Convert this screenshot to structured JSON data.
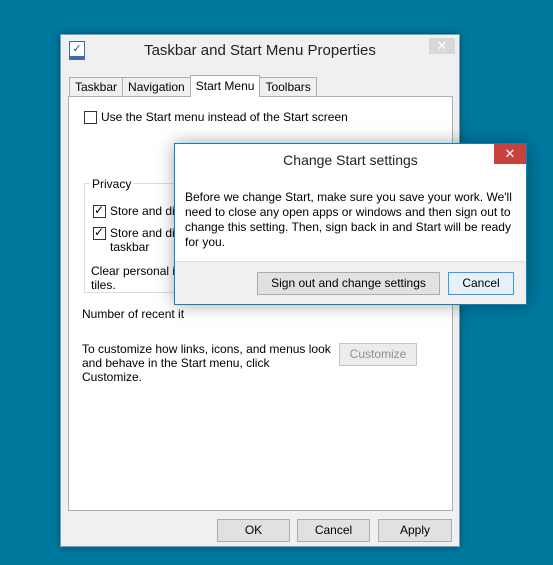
{
  "window": {
    "title": "Taskbar and Start Menu Properties",
    "close_glyph": "✕",
    "tabs": [
      {
        "label": "Taskbar"
      },
      {
        "label": "Navigation"
      },
      {
        "label": "Start Menu"
      },
      {
        "label": "Toolbars"
      }
    ],
    "start_menu_option": "Use the Start menu instead of the Start screen",
    "privacy": {
      "legend": "Privacy",
      "store_programs": "Store and disp",
      "store_items": "Store and disp",
      "store_items_line2": "taskbar",
      "clear_text": "Clear personal inf",
      "clear_text_line2": "tiles."
    },
    "recent_items_label": "Number of recent it",
    "customize_text": "To customize how links, icons, and menus look and behave in the Start menu, click Customize.",
    "customize_button": "Customize",
    "ok_button": "OK",
    "cancel_button": "Cancel",
    "apply_button": "Apply"
  },
  "dialog": {
    "title": "Change Start settings",
    "close_glyph": "✕",
    "message": "Before we change Start, make sure you save your work. We'll need to close any open apps or windows and then sign out to change this setting. Then, sign back in and Start will be ready for you.",
    "signout_button": "Sign out and change settings",
    "cancel_button": "Cancel"
  }
}
